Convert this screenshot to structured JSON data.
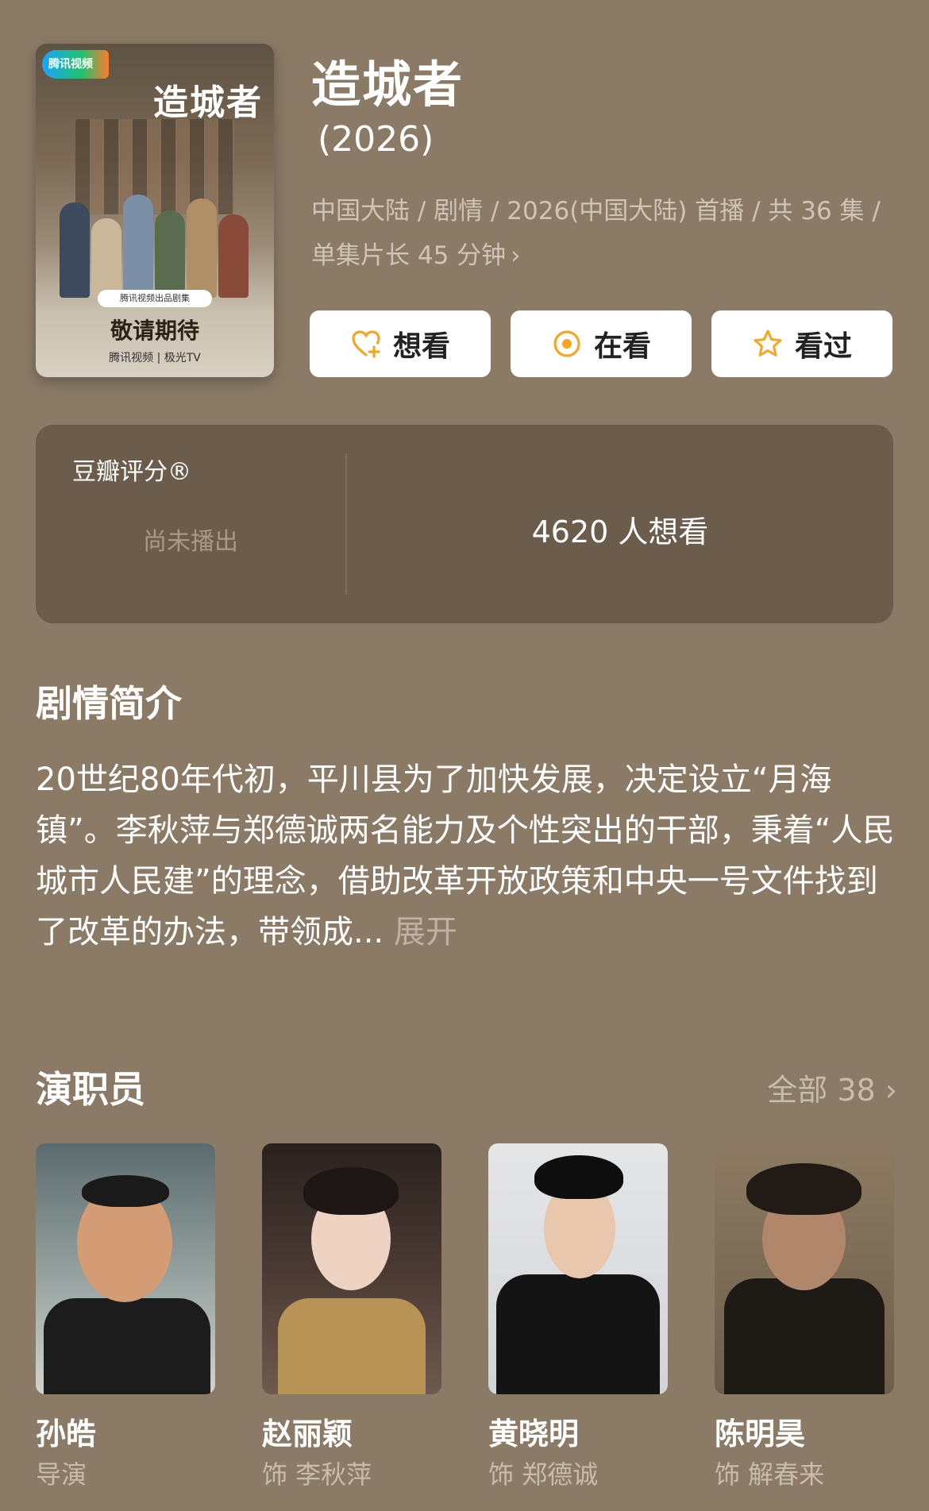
{
  "show": {
    "title": "造城者",
    "year": "(2026)",
    "meta": "中国大陆 / 剧情 / 2026(中国大陆) 首播 / 共 36 集 / 单集片长 45 分钟",
    "meta_chevron": "›"
  },
  "poster": {
    "logo_text": "腾讯视频",
    "title": "造城者",
    "badge": "腾讯视频出品剧集",
    "tagline": "敬请期待",
    "brands": "腾讯视频 | 极光TV"
  },
  "actions": {
    "want_label": "想看",
    "watching_label": "在看",
    "watched_label": "看过"
  },
  "rating": {
    "label": "豆瓣评分®",
    "status": "尚未播出",
    "want_count": "4620 人想看"
  },
  "synopsis": {
    "heading": "剧情简介",
    "text": "20世纪80年代初，平川县为了加快发展，决定设立“月海镇”。李秋萍与郑德诚两名能力及个性突出的干部，秉着“人民城市人民建”的理念，借助改革开放政策和中央一号文件找到了改革的办法，带领成...",
    "expand_label": "展开"
  },
  "cast": {
    "heading": "演职员",
    "all_label": "全部 38 ›",
    "members": [
      {
        "name": "孙皓",
        "role": "导演"
      },
      {
        "name": "赵丽颖",
        "role": "饰 李秋萍"
      },
      {
        "name": "黄晓明",
        "role": "饰 郑德诚"
      },
      {
        "name": "陈明昊",
        "role": "饰 解春来"
      }
    ]
  },
  "colors": {
    "background": "#8a7a66",
    "card": "#6b5c4c",
    "accent_orange": "#f5a623",
    "muted_text": "#c8bcad"
  }
}
